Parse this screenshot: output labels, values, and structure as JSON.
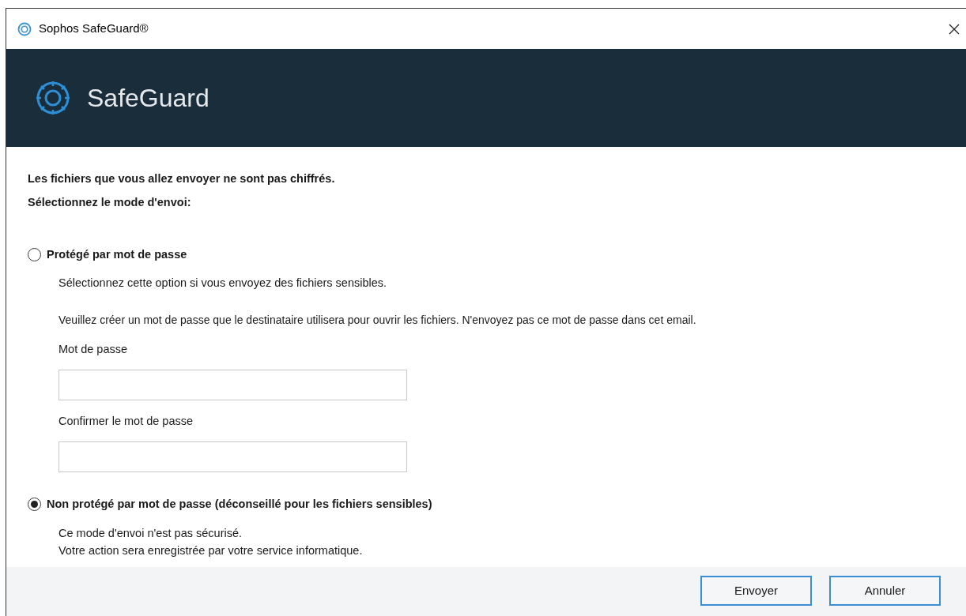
{
  "window": {
    "title": "Sophos SafeGuard®"
  },
  "header": {
    "title": "SafeGuard"
  },
  "intro": [
    "Les fichiers que vous allez envoyer ne sont pas chiffrés.",
    "Sélectionnez le mode d'envoi:"
  ],
  "options": [
    {
      "label": "Protégé par mot de passe",
      "selected": false,
      "description": [
        "Sélectionnez cette option si vous envoyez des fichiers sensibles."
      ],
      "note": "Veuillez créer un mot de passe que le destinataire utilisera pour ouvrir les fichiers. N'envoyez pas ce mot de passe dans cet email.",
      "fields": [
        {
          "label": "Mot de passe"
        },
        {
          "label": "Confirmer le mot de passe"
        }
      ]
    },
    {
      "label": "Non protégé par mot de passe (déconseillé pour les fichiers sensibles)",
      "selected": true,
      "description": [
        "Ce mode d'envoi n'est pas sécurisé.",
        "Votre action sera enregistrée par votre service informatique."
      ]
    }
  ],
  "buttons": [
    "Envoyer",
    "Annuler"
  ]
}
